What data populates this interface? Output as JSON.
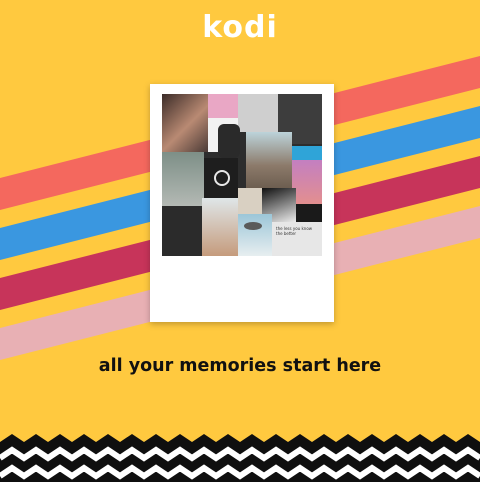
{
  "brand": {
    "logo_text": "kodi"
  },
  "tagline": "all your memories start here",
  "colors": {
    "background": "#ffc93f",
    "stripe_1": "#f4685e",
    "stripe_2": "#3a97e0",
    "stripe_3": "#c7345a",
    "stripe_4": "#e8b0b4",
    "wave_dark": "#0f0f0f",
    "wave_light": "#ffffff"
  },
  "collage": {
    "photo_caption": "the less you know the better"
  },
  "icons": [
    "polaroid-frame",
    "photo-collage"
  ]
}
